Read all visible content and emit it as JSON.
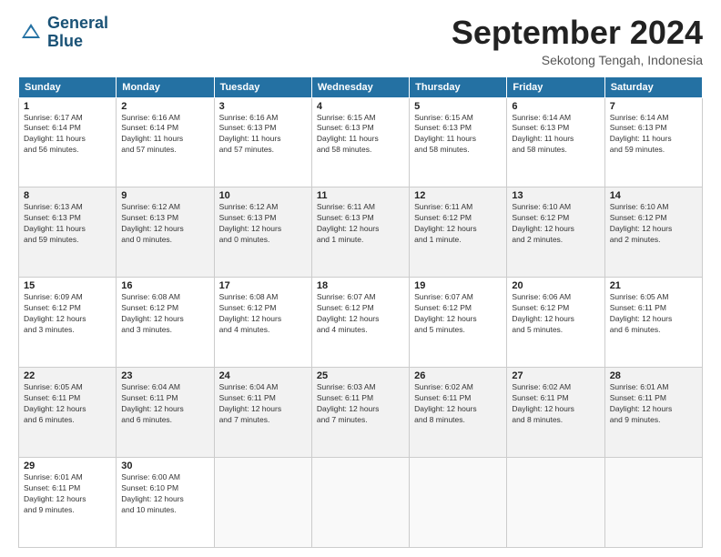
{
  "logo": {
    "line1": "General",
    "line2": "Blue"
  },
  "title": "September 2024",
  "subtitle": "Sekotong Tengah, Indonesia",
  "weekdays": [
    "Sunday",
    "Monday",
    "Tuesday",
    "Wednesday",
    "Thursday",
    "Friday",
    "Saturday"
  ],
  "weeks": [
    [
      {
        "day": "1",
        "info": "Sunrise: 6:17 AM\nSunset: 6:14 PM\nDaylight: 11 hours\nand 56 minutes."
      },
      {
        "day": "2",
        "info": "Sunrise: 6:16 AM\nSunset: 6:14 PM\nDaylight: 11 hours\nand 57 minutes."
      },
      {
        "day": "3",
        "info": "Sunrise: 6:16 AM\nSunset: 6:13 PM\nDaylight: 11 hours\nand 57 minutes."
      },
      {
        "day": "4",
        "info": "Sunrise: 6:15 AM\nSunset: 6:13 PM\nDaylight: 11 hours\nand 58 minutes."
      },
      {
        "day": "5",
        "info": "Sunrise: 6:15 AM\nSunset: 6:13 PM\nDaylight: 11 hours\nand 58 minutes."
      },
      {
        "day": "6",
        "info": "Sunrise: 6:14 AM\nSunset: 6:13 PM\nDaylight: 11 hours\nand 58 minutes."
      },
      {
        "day": "7",
        "info": "Sunrise: 6:14 AM\nSunset: 6:13 PM\nDaylight: 11 hours\nand 59 minutes."
      }
    ],
    [
      {
        "day": "8",
        "info": "Sunrise: 6:13 AM\nSunset: 6:13 PM\nDaylight: 11 hours\nand 59 minutes."
      },
      {
        "day": "9",
        "info": "Sunrise: 6:12 AM\nSunset: 6:13 PM\nDaylight: 12 hours\nand 0 minutes."
      },
      {
        "day": "10",
        "info": "Sunrise: 6:12 AM\nSunset: 6:13 PM\nDaylight: 12 hours\nand 0 minutes."
      },
      {
        "day": "11",
        "info": "Sunrise: 6:11 AM\nSunset: 6:13 PM\nDaylight: 12 hours\nand 1 minute."
      },
      {
        "day": "12",
        "info": "Sunrise: 6:11 AM\nSunset: 6:12 PM\nDaylight: 12 hours\nand 1 minute."
      },
      {
        "day": "13",
        "info": "Sunrise: 6:10 AM\nSunset: 6:12 PM\nDaylight: 12 hours\nand 2 minutes."
      },
      {
        "day": "14",
        "info": "Sunrise: 6:10 AM\nSunset: 6:12 PM\nDaylight: 12 hours\nand 2 minutes."
      }
    ],
    [
      {
        "day": "15",
        "info": "Sunrise: 6:09 AM\nSunset: 6:12 PM\nDaylight: 12 hours\nand 3 minutes."
      },
      {
        "day": "16",
        "info": "Sunrise: 6:08 AM\nSunset: 6:12 PM\nDaylight: 12 hours\nand 3 minutes."
      },
      {
        "day": "17",
        "info": "Sunrise: 6:08 AM\nSunset: 6:12 PM\nDaylight: 12 hours\nand 4 minutes."
      },
      {
        "day": "18",
        "info": "Sunrise: 6:07 AM\nSunset: 6:12 PM\nDaylight: 12 hours\nand 4 minutes."
      },
      {
        "day": "19",
        "info": "Sunrise: 6:07 AM\nSunset: 6:12 PM\nDaylight: 12 hours\nand 5 minutes."
      },
      {
        "day": "20",
        "info": "Sunrise: 6:06 AM\nSunset: 6:12 PM\nDaylight: 12 hours\nand 5 minutes."
      },
      {
        "day": "21",
        "info": "Sunrise: 6:05 AM\nSunset: 6:11 PM\nDaylight: 12 hours\nand 6 minutes."
      }
    ],
    [
      {
        "day": "22",
        "info": "Sunrise: 6:05 AM\nSunset: 6:11 PM\nDaylight: 12 hours\nand 6 minutes."
      },
      {
        "day": "23",
        "info": "Sunrise: 6:04 AM\nSunset: 6:11 PM\nDaylight: 12 hours\nand 6 minutes."
      },
      {
        "day": "24",
        "info": "Sunrise: 6:04 AM\nSunset: 6:11 PM\nDaylight: 12 hours\nand 7 minutes."
      },
      {
        "day": "25",
        "info": "Sunrise: 6:03 AM\nSunset: 6:11 PM\nDaylight: 12 hours\nand 7 minutes."
      },
      {
        "day": "26",
        "info": "Sunrise: 6:02 AM\nSunset: 6:11 PM\nDaylight: 12 hours\nand 8 minutes."
      },
      {
        "day": "27",
        "info": "Sunrise: 6:02 AM\nSunset: 6:11 PM\nDaylight: 12 hours\nand 8 minutes."
      },
      {
        "day": "28",
        "info": "Sunrise: 6:01 AM\nSunset: 6:11 PM\nDaylight: 12 hours\nand 9 minutes."
      }
    ],
    [
      {
        "day": "29",
        "info": "Sunrise: 6:01 AM\nSunset: 6:11 PM\nDaylight: 12 hours\nand 9 minutes."
      },
      {
        "day": "30",
        "info": "Sunrise: 6:00 AM\nSunset: 6:10 PM\nDaylight: 12 hours\nand 10 minutes."
      },
      {
        "day": "",
        "info": ""
      },
      {
        "day": "",
        "info": ""
      },
      {
        "day": "",
        "info": ""
      },
      {
        "day": "",
        "info": ""
      },
      {
        "day": "",
        "info": ""
      }
    ]
  ]
}
